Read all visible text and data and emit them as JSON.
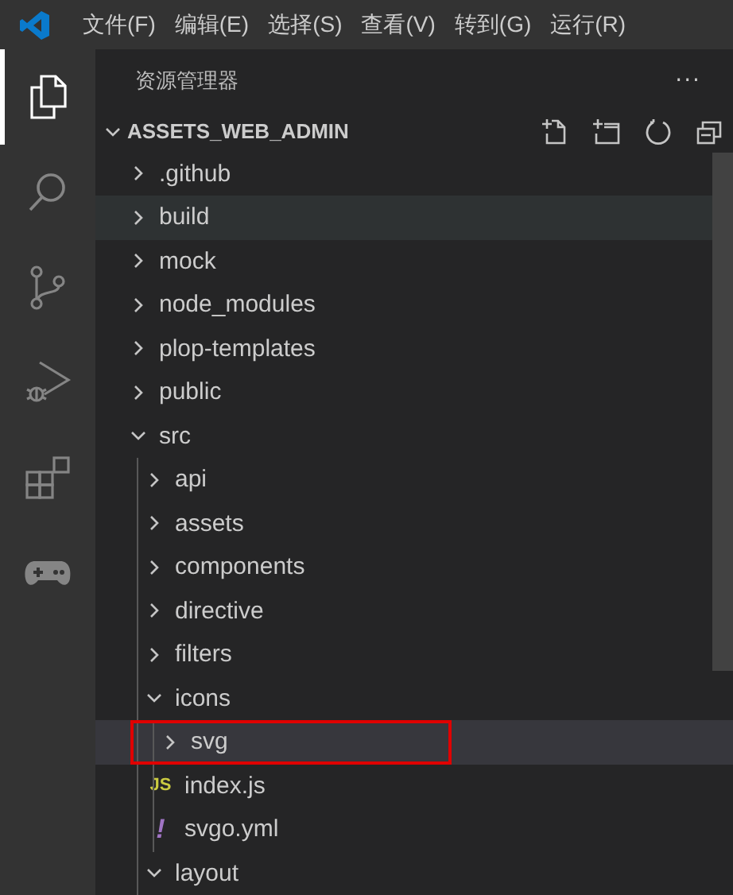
{
  "menu": [
    "文件(F)",
    "编辑(E)",
    "选择(S)",
    "查看(V)",
    "转到(G)",
    "运行(R)"
  ],
  "activity_bar": [
    {
      "kind": "explorer",
      "selected": true
    },
    {
      "kind": "search",
      "selected": false
    },
    {
      "kind": "source-control",
      "selected": false
    },
    {
      "kind": "run-debug",
      "selected": false
    },
    {
      "kind": "extensions",
      "selected": false
    },
    {
      "kind": "gamepad",
      "selected": false
    }
  ],
  "explorer": {
    "title": "资源管理器",
    "more": "···",
    "root": {
      "label": "ASSETS_WEB_ADMIN",
      "expanded": true
    },
    "tree": [
      {
        "label": ".github",
        "kind": "folder",
        "expanded": false,
        "selected": false,
        "hovered": false,
        "outlined": false
      },
      {
        "label": "build",
        "kind": "folder",
        "expanded": false,
        "selected": false,
        "hovered": true,
        "outlined": false
      },
      {
        "label": "mock",
        "kind": "folder",
        "expanded": false,
        "selected": false,
        "hovered": false,
        "outlined": false
      },
      {
        "label": "node_modules",
        "kind": "folder",
        "expanded": false,
        "selected": false,
        "hovered": false,
        "outlined": false
      },
      {
        "label": "plop-templates",
        "kind": "folder",
        "expanded": false,
        "selected": false,
        "hovered": false,
        "outlined": false
      },
      {
        "label": "public",
        "kind": "folder",
        "expanded": false,
        "selected": false,
        "hovered": false,
        "outlined": false
      },
      {
        "label": "src",
        "kind": "folder",
        "expanded": true,
        "selected": false,
        "hovered": false,
        "outlined": false,
        "children": [
          {
            "label": "api",
            "kind": "folder",
            "expanded": false,
            "selected": false,
            "hovered": false,
            "outlined": false
          },
          {
            "label": "assets",
            "kind": "folder",
            "expanded": false,
            "selected": false,
            "hovered": false,
            "outlined": false
          },
          {
            "label": "components",
            "kind": "folder",
            "expanded": false,
            "selected": false,
            "hovered": false,
            "outlined": false
          },
          {
            "label": "directive",
            "kind": "folder",
            "expanded": false,
            "selected": false,
            "hovered": false,
            "outlined": false
          },
          {
            "label": "filters",
            "kind": "folder",
            "expanded": false,
            "selected": false,
            "hovered": false,
            "outlined": false
          },
          {
            "label": "icons",
            "kind": "folder",
            "expanded": true,
            "selected": false,
            "hovered": false,
            "outlined": false,
            "children": [
              {
                "label": "svg",
                "kind": "folder",
                "expanded": false,
                "selected": true,
                "hovered": false,
                "outlined": true
              },
              {
                "label": "index.js",
                "kind": "js",
                "icon_text": "JS",
                "selected": false,
                "hovered": false,
                "outlined": false
              },
              {
                "label": "svgo.yml",
                "kind": "yml",
                "icon_text": "!",
                "selected": false,
                "hovered": false,
                "outlined": false
              }
            ]
          },
          {
            "label": "layout",
            "kind": "folder",
            "expanded": true,
            "selected": false,
            "hovered": false,
            "outlined": false
          }
        ]
      }
    ]
  }
}
